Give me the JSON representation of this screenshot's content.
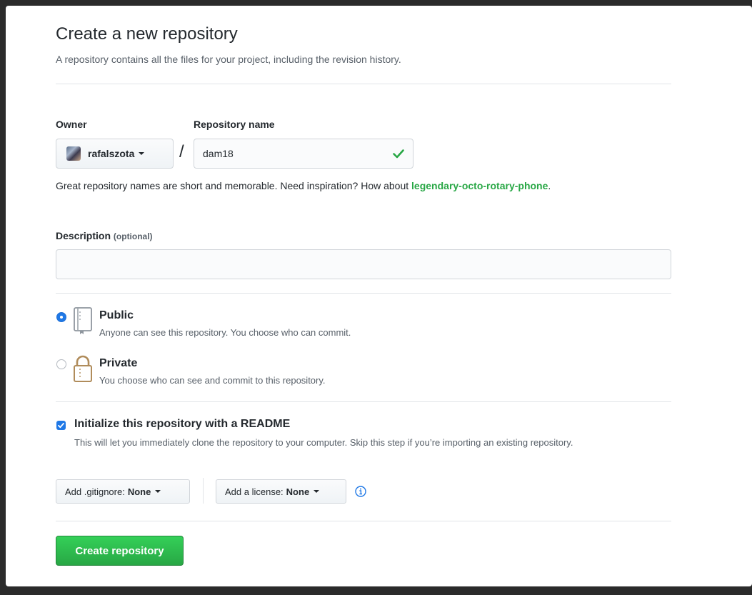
{
  "header": {
    "title": "Create a new repository",
    "subtitle": "A repository contains all the files for your project, including the revision history."
  },
  "owner": {
    "label": "Owner",
    "value": "rafalszota"
  },
  "separator": "/",
  "repo_name": {
    "label": "Repository name",
    "value": "dam18",
    "valid": true
  },
  "hint": {
    "text": "Great repository names are short and memorable. Need inspiration? How about ",
    "suggestion": "legendary-octo-rotary-phone",
    "end": "."
  },
  "description": {
    "label": "Description",
    "optional": "(optional)",
    "value": "",
    "placeholder": ""
  },
  "visibility": {
    "options": [
      {
        "label": "Public",
        "desc": "Anyone can see this repository. You choose who can commit.",
        "selected": true,
        "icon": "repo-icon"
      },
      {
        "label": "Private",
        "desc": "You choose who can see and commit to this repository.",
        "selected": false,
        "icon": "lock-icon"
      }
    ]
  },
  "readme": {
    "label": "Initialize this repository with a README",
    "desc": "This will let you immediately clone the repository to your computer. Skip this step if you’re importing an existing repository.",
    "checked": true
  },
  "gitignore": {
    "prefix": "Add .gitignore:",
    "value": "None"
  },
  "license": {
    "prefix": "Add a license:",
    "value": "None"
  },
  "submit": {
    "label": "Create repository"
  },
  "colors": {
    "accent": "#1f78e6",
    "success": "#28a745",
    "suggestion": "#28a745",
    "lock": "#b08c5b",
    "border": "#d1d5da"
  }
}
